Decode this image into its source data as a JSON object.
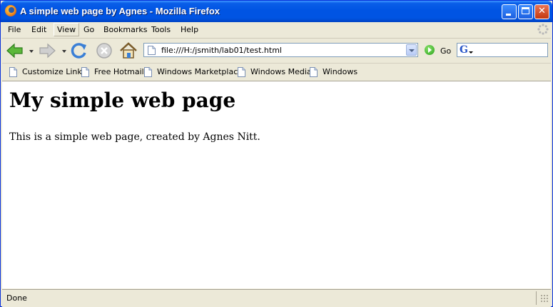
{
  "window": {
    "title": "A simple web page by Agnes - Mozilla Firefox",
    "controls": [
      "minimize",
      "maximize",
      "close"
    ]
  },
  "menu": {
    "items": [
      "File",
      "Edit",
      "View",
      "Go",
      "Bookmarks",
      "Tools",
      "Help"
    ],
    "active": "View"
  },
  "toolbar": {
    "back_icon": "back-arrow-icon",
    "forward_icon": "forward-arrow-icon",
    "reload_icon": "reload-icon",
    "stop_icon": "stop-icon",
    "home_icon": "home-icon",
    "url": "file:///H:/jsmith/lab01/test.html",
    "go_label": "Go",
    "search_engine_icon": "google-icon"
  },
  "bookmarks": [
    "Customize Links",
    "Free Hotmail",
    "Windows Marketplace",
    "Windows Media",
    "Windows"
  ],
  "page": {
    "heading": "My simple web page",
    "paragraph": "This is a simple web page, created by Agnes Nitt."
  },
  "status": {
    "text": "Done"
  },
  "colors": {
    "titlebar": "#0054e3",
    "chrome": "#ece9d8",
    "close_button": "#c3380e",
    "go_green": "#27a219"
  }
}
